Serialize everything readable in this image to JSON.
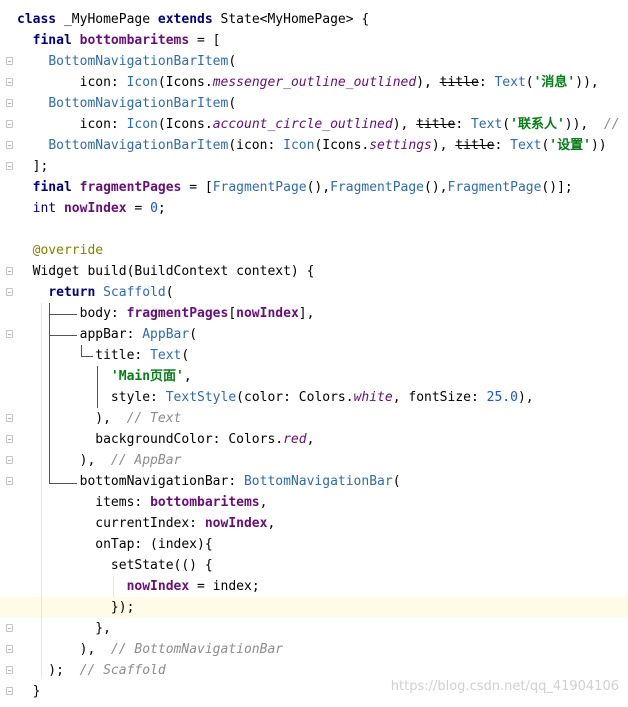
{
  "editor": {
    "language": "Dart",
    "highlighted_line": 28,
    "lines": [
      [
        {
          "t": "class ",
          "c": "kw"
        },
        {
          "t": "_MyHomePage ",
          "c": "plain"
        },
        {
          "t": "extends ",
          "c": "kw"
        },
        {
          "t": "State<MyHomePage> {",
          "c": "plain"
        }
      ],
      [
        {
          "t": "  ",
          "c": "plain"
        },
        {
          "t": "final ",
          "c": "kw"
        },
        {
          "t": "bottombaritems",
          "c": "field"
        },
        {
          "t": " = [",
          "c": "plain"
        }
      ],
      [
        {
          "t": "    ",
          "c": "plain"
        },
        {
          "t": "BottomNavigationBarItem",
          "c": "ctor"
        },
        {
          "t": "(",
          "c": "plain"
        }
      ],
      [
        {
          "t": "        icon: ",
          "c": "plain"
        },
        {
          "t": "Icon",
          "c": "ctor"
        },
        {
          "t": "(Icons.",
          "c": "plain"
        },
        {
          "t": "messenger_outline_outlined",
          "c": "italic"
        },
        {
          "t": "), ",
          "c": "plain"
        },
        {
          "t": "title",
          "c": "strike"
        },
        {
          "t": ": ",
          "c": "plain"
        },
        {
          "t": "Text",
          "c": "ctor"
        },
        {
          "t": "(",
          "c": "plain"
        },
        {
          "t": "'消息'",
          "c": "str"
        },
        {
          "t": ")),",
          "c": "plain"
        }
      ],
      [
        {
          "t": "    ",
          "c": "plain"
        },
        {
          "t": "BottomNavigationBarItem",
          "c": "ctor"
        },
        {
          "t": "(",
          "c": "plain"
        }
      ],
      [
        {
          "t": "        icon: ",
          "c": "plain"
        },
        {
          "t": "Icon",
          "c": "ctor"
        },
        {
          "t": "(Icons.",
          "c": "plain"
        },
        {
          "t": "account_circle_outlined",
          "c": "italic"
        },
        {
          "t": "), ",
          "c": "plain"
        },
        {
          "t": "title",
          "c": "strike"
        },
        {
          "t": ": ",
          "c": "plain"
        },
        {
          "t": "Text",
          "c": "ctor"
        },
        {
          "t": "(",
          "c": "plain"
        },
        {
          "t": "'联系人'",
          "c": "str"
        },
        {
          "t": ")),  ",
          "c": "plain"
        },
        {
          "t": "//",
          "c": "cmt"
        }
      ],
      [
        {
          "t": "    ",
          "c": "plain"
        },
        {
          "t": "BottomNavigationBarItem",
          "c": "ctor"
        },
        {
          "t": "(icon: ",
          "c": "plain"
        },
        {
          "t": "Icon",
          "c": "ctor"
        },
        {
          "t": "(Icons.",
          "c": "plain"
        },
        {
          "t": "settings",
          "c": "italic"
        },
        {
          "t": "), ",
          "c": "plain"
        },
        {
          "t": "title",
          "c": "strike"
        },
        {
          "t": ": ",
          "c": "plain"
        },
        {
          "t": "Text",
          "c": "ctor"
        },
        {
          "t": "(",
          "c": "plain"
        },
        {
          "t": "'设置'",
          "c": "str"
        },
        {
          "t": "))",
          "c": "plain"
        }
      ],
      [
        {
          "t": "  ];",
          "c": "plain"
        }
      ],
      [
        {
          "t": "  ",
          "c": "plain"
        },
        {
          "t": "final ",
          "c": "kw"
        },
        {
          "t": "fragmentPages",
          "c": "field"
        },
        {
          "t": " = [",
          "c": "plain"
        },
        {
          "t": "FragmentPage",
          "c": "ctor"
        },
        {
          "t": "(),",
          "c": "plain"
        },
        {
          "t": "FragmentPage",
          "c": "ctor"
        },
        {
          "t": "(),",
          "c": "plain"
        },
        {
          "t": "FragmentPage",
          "c": "ctor"
        },
        {
          "t": "()];",
          "c": "plain"
        }
      ],
      [
        {
          "t": "  ",
          "c": "plain"
        },
        {
          "t": "int ",
          "c": "kw2"
        },
        {
          "t": "nowIndex",
          "c": "field"
        },
        {
          "t": " = ",
          "c": "plain"
        },
        {
          "t": "0",
          "c": "num"
        },
        {
          "t": ";",
          "c": "plain"
        }
      ],
      [
        {
          "t": "",
          "c": "plain"
        }
      ],
      [
        {
          "t": "  ",
          "c": "plain"
        },
        {
          "t": "@override",
          "c": "ann"
        }
      ],
      [
        {
          "t": "  Widget build(BuildContext context) {",
          "c": "plain"
        }
      ],
      [
        {
          "t": "    ",
          "c": "plain"
        },
        {
          "t": "return ",
          "c": "kw"
        },
        {
          "t": "Scaffold",
          "c": "ctor"
        },
        {
          "t": "(",
          "c": "plain"
        }
      ],
      [
        {
          "t": "        body: ",
          "c": "plain"
        },
        {
          "t": "fragmentPages",
          "c": "field"
        },
        {
          "t": "[",
          "c": "plain"
        },
        {
          "t": "nowIndex",
          "c": "field"
        },
        {
          "t": "],",
          "c": "plain"
        }
      ],
      [
        {
          "t": "        appBar: ",
          "c": "plain"
        },
        {
          "t": "AppBar",
          "c": "ctor"
        },
        {
          "t": "(",
          "c": "plain"
        }
      ],
      [
        {
          "t": "          title: ",
          "c": "plain"
        },
        {
          "t": "Text",
          "c": "ctor"
        },
        {
          "t": "(",
          "c": "plain"
        }
      ],
      [
        {
          "t": "            ",
          "c": "plain"
        },
        {
          "t": "'Main页面'",
          "c": "str"
        },
        {
          "t": ",",
          "c": "plain"
        }
      ],
      [
        {
          "t": "            style: ",
          "c": "plain"
        },
        {
          "t": "TextStyle",
          "c": "ctor"
        },
        {
          "t": "(color: Colors.",
          "c": "plain"
        },
        {
          "t": "white",
          "c": "italic"
        },
        {
          "t": ", fontSize: ",
          "c": "plain"
        },
        {
          "t": "25.0",
          "c": "num"
        },
        {
          "t": "),",
          "c": "plain"
        }
      ],
      [
        {
          "t": "          ),  ",
          "c": "plain"
        },
        {
          "t": "// Text",
          "c": "cmt"
        }
      ],
      [
        {
          "t": "          backgroundColor: Colors.",
          "c": "plain"
        },
        {
          "t": "red",
          "c": "italic"
        },
        {
          "t": ",",
          "c": "plain"
        }
      ],
      [
        {
          "t": "        ),  ",
          "c": "plain"
        },
        {
          "t": "// AppBar",
          "c": "cmt"
        }
      ],
      [
        {
          "t": "        bottomNavigationBar: ",
          "c": "plain"
        },
        {
          "t": "BottomNavigationBar",
          "c": "ctor"
        },
        {
          "t": "(",
          "c": "plain"
        }
      ],
      [
        {
          "t": "          items: ",
          "c": "plain"
        },
        {
          "t": "bottombaritems",
          "c": "field"
        },
        {
          "t": ",",
          "c": "plain"
        }
      ],
      [
        {
          "t": "          currentIndex: ",
          "c": "plain"
        },
        {
          "t": "nowIndex",
          "c": "field"
        },
        {
          "t": ",",
          "c": "plain"
        }
      ],
      [
        {
          "t": "          onTap: (index){",
          "c": "plain"
        }
      ],
      [
        {
          "t": "            setState(() {",
          "c": "plain"
        }
      ],
      [
        {
          "t": "              ",
          "c": "plain"
        },
        {
          "t": "nowIndex",
          "c": "field"
        },
        {
          "t": " = index;",
          "c": "plain"
        }
      ],
      [
        {
          "t": "            });",
          "c": "plain"
        }
      ],
      [
        {
          "t": "          },",
          "c": "plain"
        }
      ],
      [
        {
          "t": "        ),  ",
          "c": "plain"
        },
        {
          "t": "// BottomNavigationBar",
          "c": "cmt"
        }
      ],
      [
        {
          "t": "    );  ",
          "c": "plain"
        },
        {
          "t": "// Scaffold",
          "c": "cmt"
        }
      ],
      [
        {
          "t": "  }",
          "c": "plain"
        }
      ]
    ]
  },
  "watermark": "https://blog.csdn.net/qq_41904106"
}
